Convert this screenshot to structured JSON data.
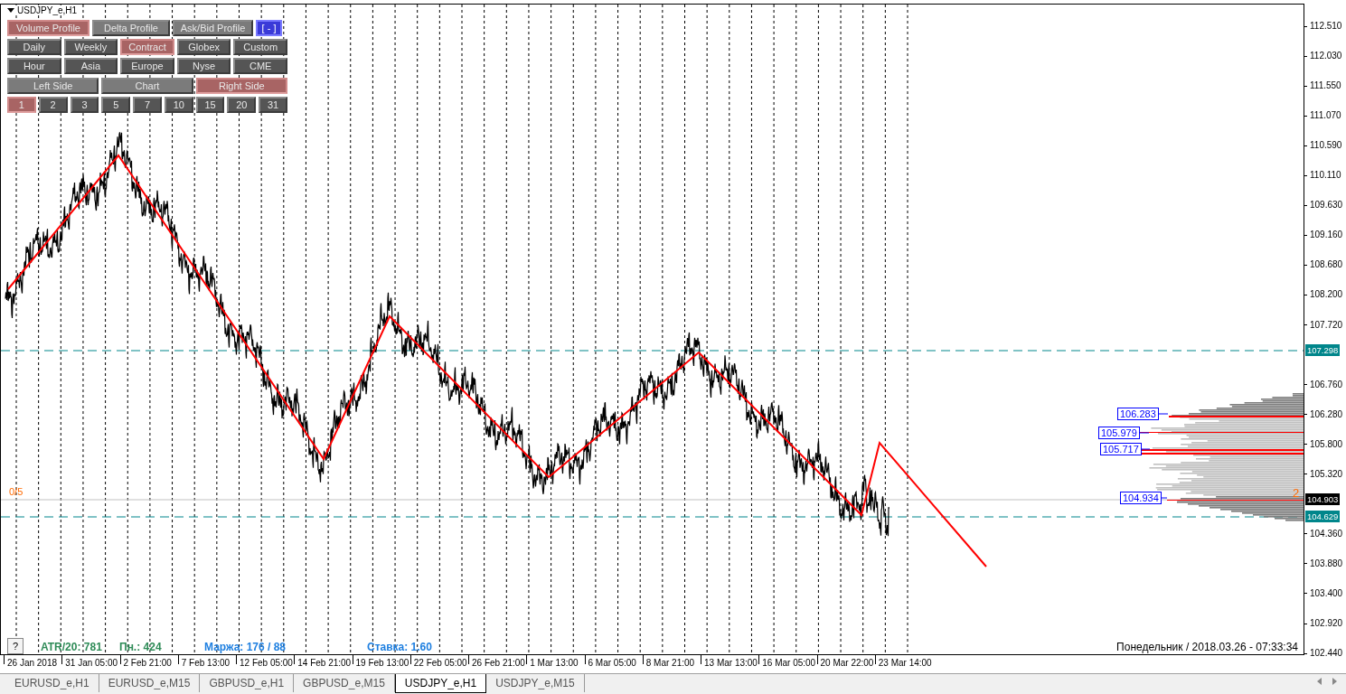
{
  "chart": {
    "symbol": "USDJPY_e,H1",
    "mode_buttons": [
      {
        "label": "Volume Profile",
        "selected": true
      },
      {
        "label": "Delta Profile",
        "selected": false
      },
      {
        "label": "Ask/Bid Profile",
        "selected": false
      }
    ],
    "collapse_button": "[ - ]",
    "session_buttons": [
      {
        "label": "Daily",
        "selected": false
      },
      {
        "label": "Weekly",
        "selected": false
      },
      {
        "label": "Contract",
        "selected": true
      },
      {
        "label": "Globex",
        "selected": false
      },
      {
        "label": "Custom",
        "selected": false
      },
      {
        "label": "Hour",
        "selected": false
      },
      {
        "label": "Asia",
        "selected": false
      },
      {
        "label": "Europe",
        "selected": false
      },
      {
        "label": "Nyse",
        "selected": false
      },
      {
        "label": "CME",
        "selected": false
      }
    ],
    "side_buttons": [
      {
        "label": "Left Side",
        "selected": false
      },
      {
        "label": "Chart",
        "selected": false
      },
      {
        "label": "Right Side",
        "selected": true
      }
    ],
    "count_buttons": [
      {
        "label": "1",
        "selected": true
      },
      {
        "label": "2",
        "selected": false
      },
      {
        "label": "3",
        "selected": false
      },
      {
        "label": "5",
        "selected": false
      },
      {
        "label": "7",
        "selected": false
      },
      {
        "label": "10",
        "selected": false
      },
      {
        "label": "15",
        "selected": false
      },
      {
        "label": "20",
        "selected": false
      },
      {
        "label": "31",
        "selected": false
      }
    ],
    "level_label": "0/5",
    "profile_labels": [
      "106.283",
      "105.979",
      "105.717",
      "104.934"
    ],
    "profile_count": "2",
    "help_button": "?",
    "stats": [
      {
        "text": "ATR/20: 781",
        "color": "#2e8b57"
      },
      {
        "text": "Пн.: 424",
        "color": "#2e8b57"
      },
      {
        "text": "Маржа: 176 / 88",
        "color": "#1e7fe0"
      },
      {
        "text": "Ставка: 1.60",
        "color": "#1e7fe0"
      }
    ],
    "clock": "Понедельник / 2018.03.26 - 07:33:34"
  },
  "price_axis": {
    "ticks": [
      "112.510",
      "112.030",
      "111.550",
      "111.070",
      "110.590",
      "110.110",
      "109.630",
      "109.160",
      "108.680",
      "108.200",
      "107.720",
      "106.760",
      "106.280",
      "105.800",
      "105.320",
      "104.360",
      "103.880",
      "103.400",
      "102.920",
      "102.440"
    ],
    "markers": [
      {
        "text": "107.298",
        "kind": "level"
      },
      {
        "text": "104.903",
        "kind": "bid"
      },
      {
        "text": "104.629",
        "kind": "level"
      }
    ]
  },
  "time_axis": {
    "ticks": [
      "26 Jan 2018",
      "31 Jan 05:00",
      "2 Feb 21:00",
      "7 Feb 13:00",
      "12 Feb 05:00",
      "14 Feb 21:00",
      "19 Feb 13:00",
      "22 Feb 05:00",
      "26 Feb 21:00",
      "1 Mar 13:00",
      "6 Mar 05:00",
      "8 Mar 21:00",
      "13 Mar 13:00",
      "16 Mar 05:00",
      "20 Mar 22:00",
      "23 Mar 14:00"
    ]
  },
  "tabs": [
    {
      "label": "EURUSD_e,H1",
      "selected": false
    },
    {
      "label": "EURUSD_e,M15",
      "selected": false
    },
    {
      "label": "GBPUSD_e,H1",
      "selected": false
    },
    {
      "label": "GBPUSD_e,M15",
      "selected": false
    },
    {
      "label": "USDJPY_e,H1",
      "selected": true
    },
    {
      "label": "USDJPY_e,M15",
      "selected": false
    }
  ]
}
